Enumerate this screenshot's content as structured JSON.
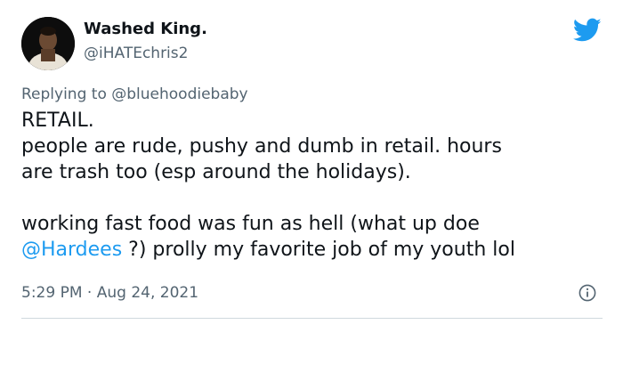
{
  "user": {
    "display_name": "Washed King.",
    "handle": "@iHATEchris2"
  },
  "reply": {
    "prefix": "Replying to ",
    "mention": "@bluehoodiebaby"
  },
  "body": {
    "line1": "RETAIL.",
    "line2": "people are rude, pushy and dumb in retail. hours",
    "line3": "are trash too (esp around the holidays).",
    "line4": "working fast food was fun as hell (what up doe",
    "line5_link": "@Hardees",
    "line5_rest": " ?) prolly my favorite job of my youth lol"
  },
  "meta": {
    "time": "5:29 PM",
    "separator": " · ",
    "date": "Aug 24, 2021"
  },
  "icons": {
    "brand": "twitter-bird-icon",
    "info": "info-icon",
    "brand_color": "#1d9bf0"
  }
}
